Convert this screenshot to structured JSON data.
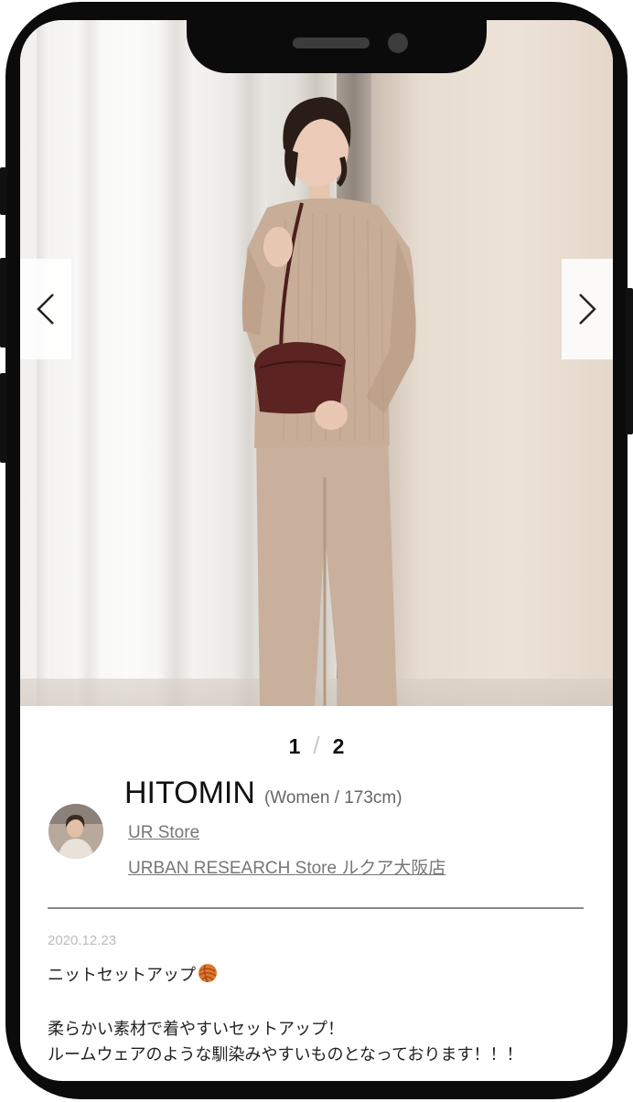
{
  "pager": {
    "current": "1",
    "separator": "/",
    "total": "2"
  },
  "profile": {
    "name": "HITOMIN",
    "meta": "(Women / 173cm)",
    "store_link": "UR Store",
    "shop_link": "URBAN RESEARCH Store ルクア大阪店"
  },
  "post": {
    "date": "2020.12.23",
    "title": "ニットセットアップ",
    "title_icon": "yarn-ball-icon",
    "body_line_1": "柔らかい素材で着やすいセットアップ！",
    "body_line_2": "ルームウェアのような馴染みやすいものとなっております！！！"
  },
  "carousel": {
    "prev_icon": "chevron-left-icon",
    "next_icon": "chevron-right-icon"
  },
  "colors": {
    "frame": "#0b0b0b",
    "text": "#111111",
    "link": "#777777",
    "date": "#bcbcbc",
    "divider": "#8a8a8a"
  }
}
